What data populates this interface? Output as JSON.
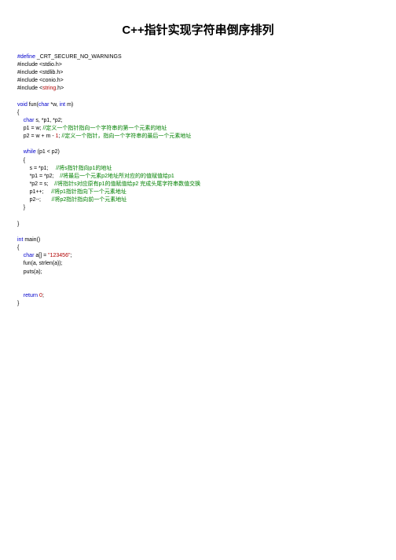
{
  "title": "C++指针实现字符串倒序排列",
  "code": {
    "l01a": "#define",
    "l01b": " _CRT_SECURE_NO_WARNINGS",
    "l02": "#include <stdio.h>",
    "l03": "#include <stdlib.h>",
    "l04": "#include <conio.h>",
    "l05a": "#include <",
    "l05b": "string",
    "l05c": ".h>",
    "l06a": "void",
    "l06b": " fun(",
    "l06c": "char",
    "l06d": " *w, ",
    "l06e": "int",
    "l06f": " m)",
    "l07": "{",
    "l08a": "char",
    "l08b": " s, *p1, *p2;",
    "l09": "p1 = w; ",
    "l09c": "//定义一个指针指向一个字符串的第一个元素的地址",
    "l10a": "p2 = w + m - ",
    "l10n": "1",
    "l10b": "; ",
    "l10c": "//定义一个指针，指向一个字符串的最后一个元素地址",
    "l11a": "while",
    "l11b": " (p1 < p2)",
    "l12": "{",
    "l13a": "s = *p1;     ",
    "l13c": "//将s指针指向p1的地址",
    "l14a": "*p1 = *p2;    ",
    "l14c": "//将最后一个元素p2地址所对应的的值赋值给p1",
    "l15a": "*p2 = s;    ",
    "l15c": "//将指针s对应原有p1的值赋值给p2 完成头尾字符串数值交换",
    "l16a": "p1++;     ",
    "l16c": "//将p1指针指向下一个元素地址",
    "l17a": "p2--;       ",
    "l17c": "//将p2指针指向前一个元素地址",
    "l18": "}",
    "l19": "}",
    "l20a": "int",
    "l20b": " main()",
    "l21": "{",
    "l22a": "char",
    "l22b": " a[] = ",
    "l22s": "\"123456\"",
    "l22c": ";",
    "l23": "fun(a, strlen(a));",
    "l24": "puts(a);",
    "l25a": "return",
    "l25b": " ",
    "l25n": "0",
    "l25c": ";",
    "l26": "}"
  }
}
